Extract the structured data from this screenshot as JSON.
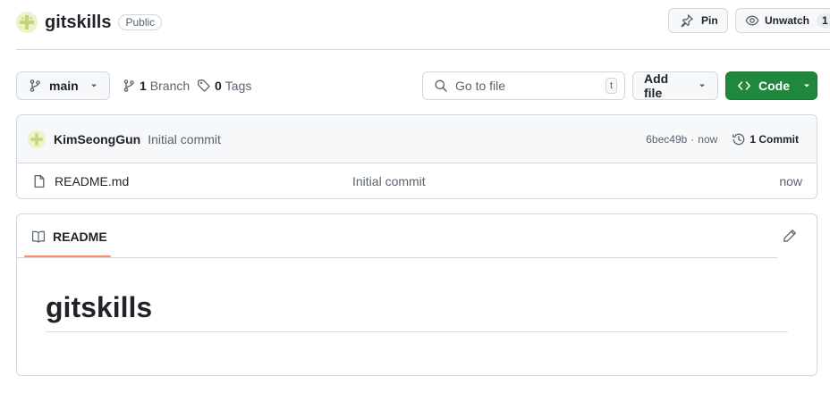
{
  "repo": {
    "name": "gitskills",
    "visibility": "Public",
    "pin_label": "Pin",
    "unwatch_label": "Unwatch",
    "watch_count": "1"
  },
  "toolbar": {
    "branch": "main",
    "branch_count": "1",
    "branch_word": "Branch",
    "tag_count": "0",
    "tag_word": "Tags",
    "search_placeholder": "Go to file",
    "search_shortcut": "t",
    "add_file_label": "Add file",
    "code_label": "Code"
  },
  "commit_bar": {
    "author": "KimSeongGun",
    "message": "Initial commit",
    "hash": "6bec49b",
    "separator": "·",
    "time": "now",
    "commit_count_label": "1 Commit"
  },
  "files": [
    {
      "name": "README.md",
      "commit_message": "Initial commit",
      "age": "now"
    }
  ],
  "readme": {
    "tab_label": "README",
    "heading": "gitskills"
  },
  "icons": {
    "repo_avatar": "identicon-avatar",
    "pin": "pin-icon",
    "unwatch": "eye-icon",
    "branch": "git-branch-icon",
    "tag": "tag-icon",
    "search": "search-icon",
    "history": "history-icon",
    "file": "file-icon",
    "book": "book-icon",
    "edit": "pencil-icon"
  },
  "colors": {
    "accent_green": "#1f883d",
    "tab_underline": "#fd8c73",
    "border": "#d0d7de",
    "muted_text": "#59636e"
  }
}
